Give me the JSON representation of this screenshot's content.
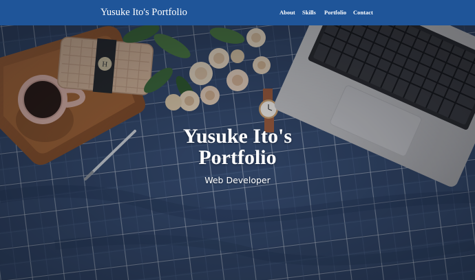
{
  "navbar": {
    "brand": "Yusuke Ito's Portfolio",
    "links": [
      "About",
      "Skills",
      "Portfolio",
      "Contact"
    ],
    "background_color": "#1f5599"
  },
  "hero": {
    "title_line1": "Yusuke Ito's",
    "title_line2": "Portfolio",
    "subtitle": "Web Developer"
  }
}
